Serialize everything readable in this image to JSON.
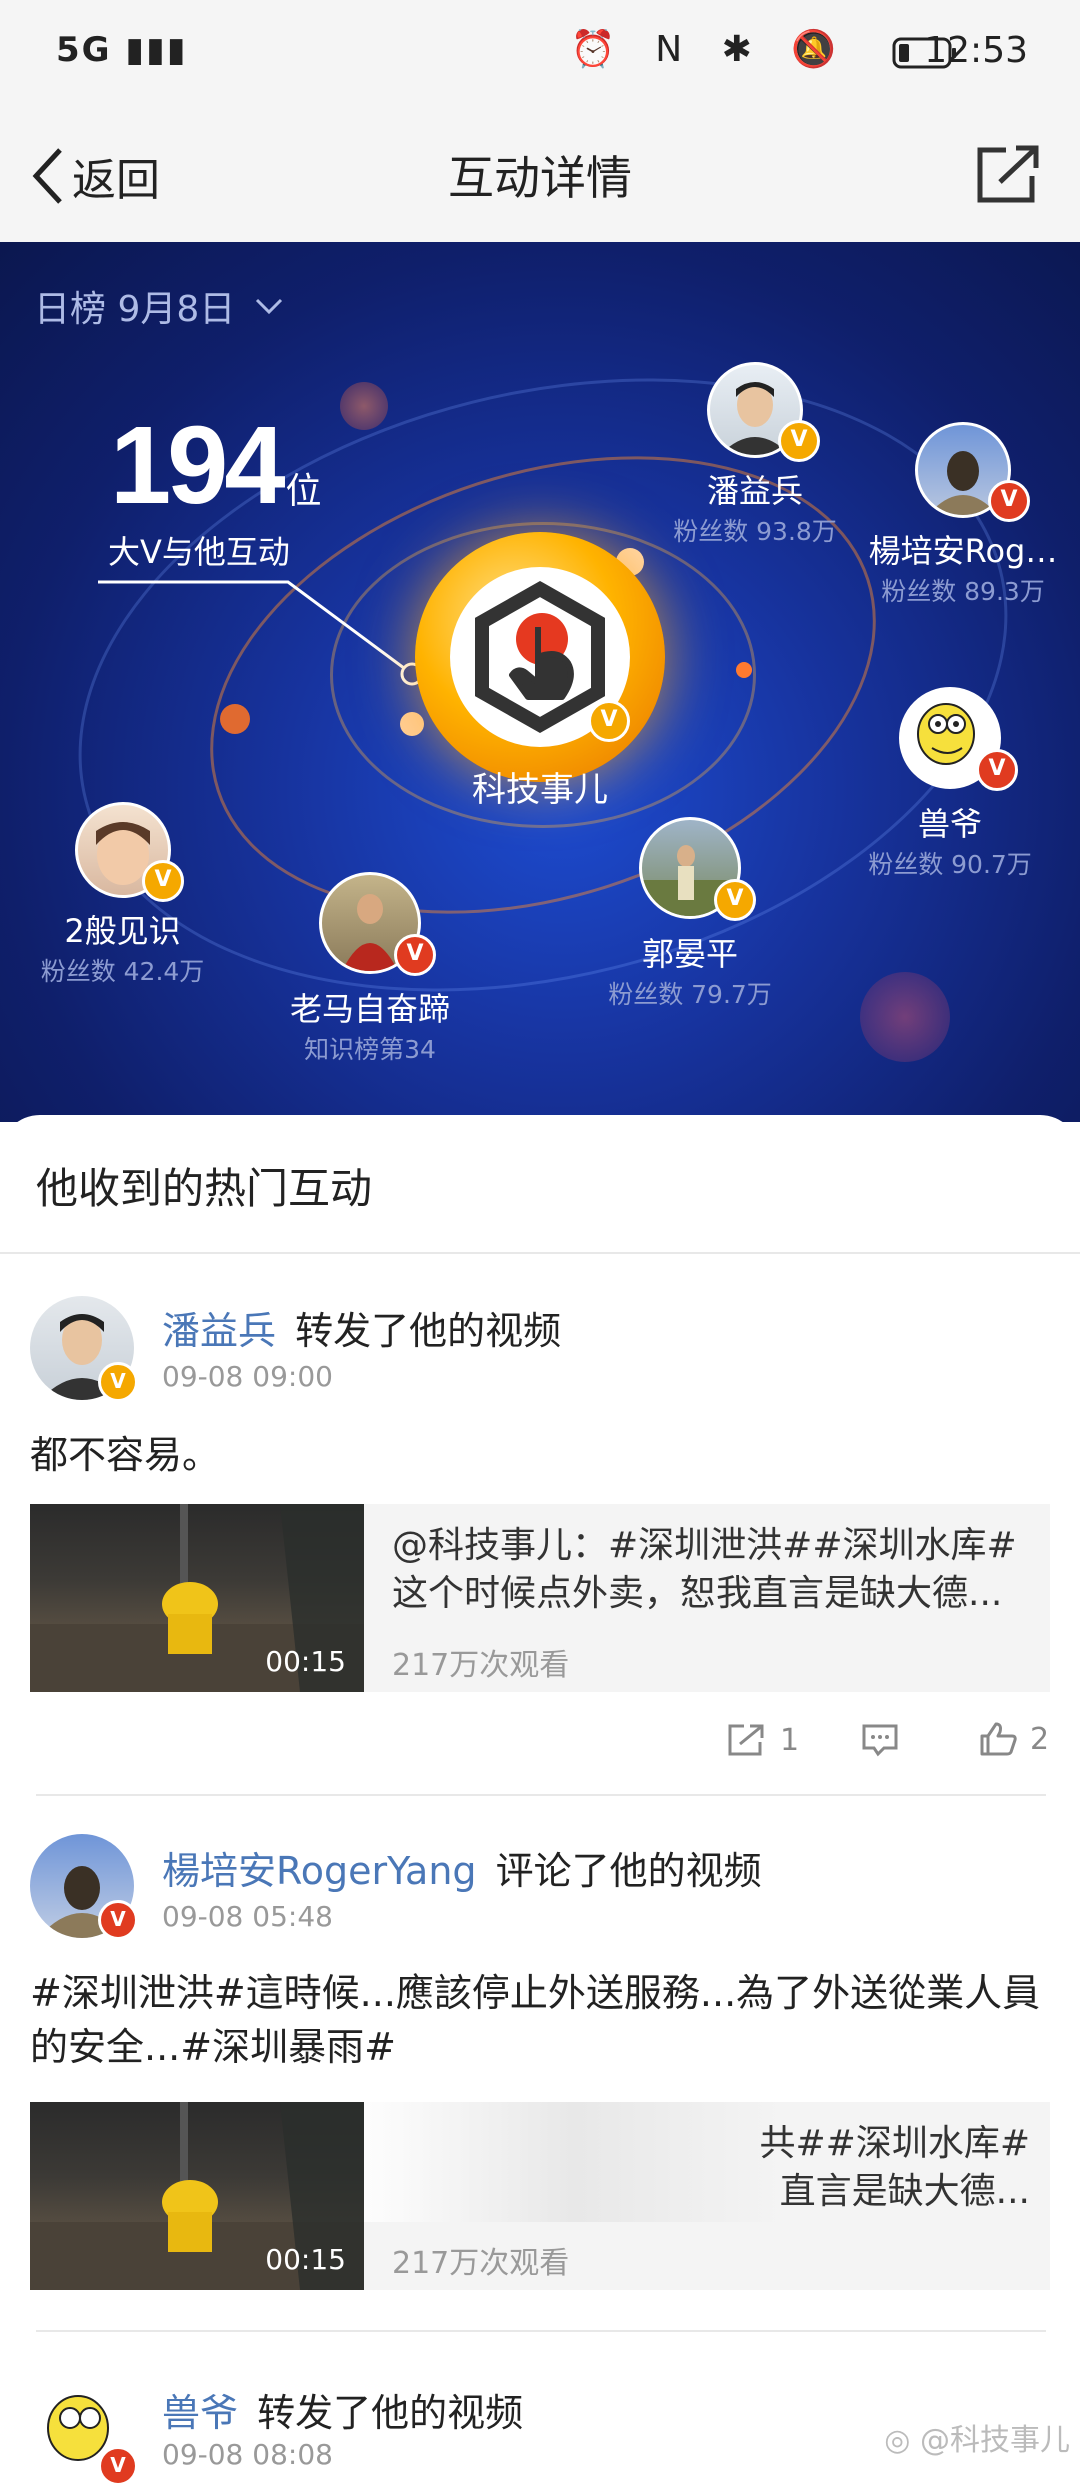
{
  "status": {
    "network": "5G",
    "time": "12:53",
    "icons": [
      "alarm-icon",
      "nfc-icon",
      "bluetooth-icon",
      "mute-icon",
      "battery-icon"
    ]
  },
  "nav": {
    "back_label": "返回",
    "title": "互动详情"
  },
  "hero": {
    "rank_selector": "日榜 9月8日",
    "count": "194",
    "count_unit": "位",
    "count_caption": "大V与他互动",
    "center_name": "科技事儿",
    "users": [
      {
        "name": "潘益兵",
        "sub": "粉丝数 93.8万"
      },
      {
        "name": "楊培安Rog…",
        "sub": "粉丝数 89.3万"
      },
      {
        "name": "兽爷",
        "sub": "粉丝数 90.7万"
      },
      {
        "name": "郭晏平",
        "sub": "粉丝数 79.7万"
      },
      {
        "name": "老马自奋蹄",
        "sub": "知识榜第34"
      },
      {
        "name": "2般见识",
        "sub": "粉丝数 42.4万"
      }
    ]
  },
  "section_title": "他收到的热门互动",
  "feed": [
    {
      "name": "潘益兵",
      "action": "转发了他的视频",
      "time": "09-08 09:00",
      "text": "都不容易。",
      "video": {
        "title": "@科技事儿：#深圳泄洪##深圳水库#这个时候点外卖，恕我直言是缺大德...",
        "views": "217万次观看",
        "duration": "00:15"
      },
      "share_count": "1",
      "like_count": "2"
    },
    {
      "name": "楊培安RogerYang",
      "action": "评论了他的视频",
      "time": "09-08 05:48",
      "text": "#深圳泄洪#這時候...應該停止外送服務...為了外送從業人員的安全...#深圳暴雨#",
      "video": {
        "title": "共##深圳水库#\n直言是缺大德...",
        "views": "217万次观看",
        "duration": "00:15"
      }
    },
    {
      "name": "兽爷",
      "action": "转发了他的视频",
      "time": "09-08 08:08"
    }
  ],
  "watermark": "@科技事儿"
}
